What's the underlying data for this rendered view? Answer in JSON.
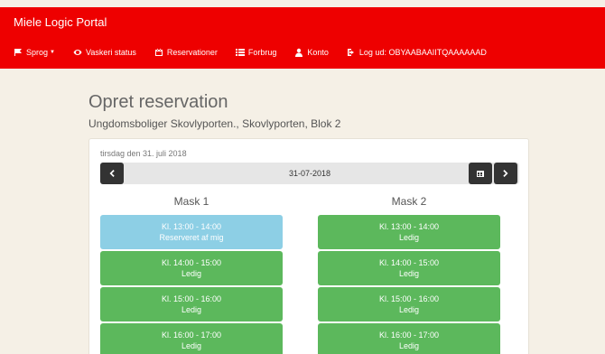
{
  "navbar": {
    "brand": "Miele Logic Portal",
    "items": [
      {
        "label": "Sprog",
        "icon": "flag-icon"
      },
      {
        "label": "Vaskeri status",
        "icon": "eye-icon"
      },
      {
        "label": "Reservationer",
        "icon": "calendar-icon"
      },
      {
        "label": "Forbrug",
        "icon": "list-icon"
      },
      {
        "label": "Konto",
        "icon": "user-icon"
      },
      {
        "label": "Log ud: OBYAABAAIITQAAAAAAD",
        "icon": "logout-icon"
      }
    ]
  },
  "page": {
    "title": "Opret reservation",
    "subtitle": "Ungdomsboliger Skovlyporten., Skovlyporten, Blok 2"
  },
  "calendar": {
    "day_label": "tirsdag den 31. juli 2018",
    "date": "31-07-2018"
  },
  "machines": [
    {
      "name": "Mask 1",
      "slots": [
        {
          "time": "Kl. 13:00 - 14:00",
          "status": "Reserveret af mig"
        },
        {
          "time": "Kl. 14:00 - 15:00",
          "status": "Ledig"
        },
        {
          "time": "Kl. 15:00 - 16:00",
          "status": "Ledig"
        },
        {
          "time": "Kl. 16:00 - 17:00",
          "status": "Ledig"
        }
      ]
    },
    {
      "name": "Mask 2",
      "slots": [
        {
          "time": "Kl. 13:00 - 14:00",
          "status": "Ledig"
        },
        {
          "time": "Kl. 14:00 - 15:00",
          "status": "Ledig"
        },
        {
          "time": "Kl. 15:00 - 16:00",
          "status": "Ledig"
        },
        {
          "time": "Kl. 16:00 - 17:00",
          "status": "Ledig"
        }
      ]
    }
  ],
  "colors": {
    "navbar": "#ee0000",
    "available": "#5cb85c",
    "reserved_by_me": "#8dcfe5"
  }
}
